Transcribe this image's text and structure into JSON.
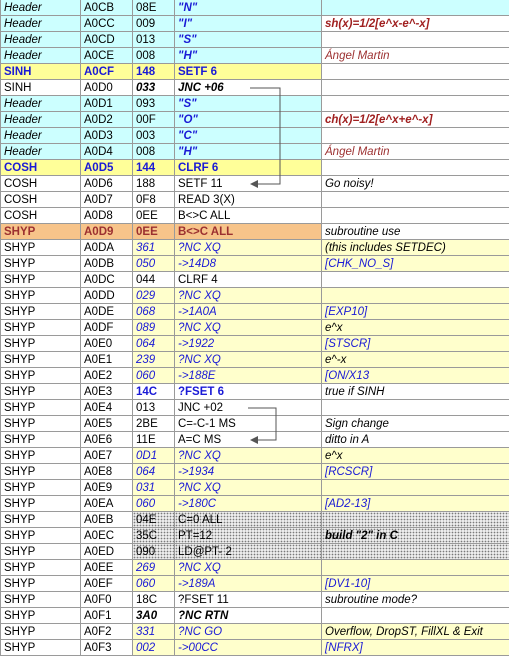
{
  "rows": [
    {
      "label": "Header",
      "addr": "A0CB",
      "code": "08E",
      "instr": "\"N\"",
      "note": ""
    },
    {
      "label": "Header",
      "addr": "A0CC",
      "code": "009",
      "instr": "\"I\"",
      "note": "sh(x)=1/2[e^x-e^-x]"
    },
    {
      "label": "Header",
      "addr": "A0CD",
      "code": "013",
      "instr": "\"S\"",
      "note": ""
    },
    {
      "label": "Header",
      "addr": "A0CE",
      "code": "008",
      "instr": "\"H\"",
      "note": "Ángel Martin"
    },
    {
      "label": "SINH",
      "addr": "A0CF",
      "code": "148",
      "instr": "SETF 6",
      "note": ""
    },
    {
      "label": "SINH",
      "addr": "A0D0",
      "code": "033",
      "instr": "JNC +06",
      "note": ""
    },
    {
      "label": "Header",
      "addr": "A0D1",
      "code": "093",
      "instr": "\"S\"",
      "note": ""
    },
    {
      "label": "Header",
      "addr": "A0D2",
      "code": "00F",
      "instr": "\"O\"",
      "note": "ch(x)=1/2[e^x+e^-x]"
    },
    {
      "label": "Header",
      "addr": "A0D3",
      "code": "003",
      "instr": "\"C\"",
      "note": ""
    },
    {
      "label": "Header",
      "addr": "A0D4",
      "code": "008",
      "instr": "\"H\"",
      "note": "Ángel Martin"
    },
    {
      "label": "COSH",
      "addr": "A0D5",
      "code": "144",
      "instr": "CLRF 6",
      "note": ""
    },
    {
      "label": "COSH",
      "addr": "A0D6",
      "code": "188",
      "instr": "SETF 11",
      "note": "Go noisy!"
    },
    {
      "label": "COSH",
      "addr": "A0D7",
      "code": "0F8",
      "instr": "READ 3(X)",
      "note": ""
    },
    {
      "label": "COSH",
      "addr": "A0D8",
      "code": "0EE",
      "instr": "B<>C ALL",
      "note": ""
    },
    {
      "label": "SHYP",
      "addr": "A0D9",
      "code": "0EE",
      "instr": "B<>C ALL",
      "note": "subroutine use"
    },
    {
      "label": "SHYP",
      "addr": "A0DA",
      "code": "361",
      "instr": "?NC XQ",
      "note": "(this includes SETDEC)"
    },
    {
      "label": "SHYP",
      "addr": "A0DB",
      "code": "050",
      "instr": "->14D8",
      "note": "[CHK_NO_S]"
    },
    {
      "label": "SHYP",
      "addr": "A0DC",
      "code": "044",
      "instr": "CLRF 4",
      "note": ""
    },
    {
      "label": "SHYP",
      "addr": "A0DD",
      "code": "029",
      "instr": "?NC XQ",
      "note": ""
    },
    {
      "label": "SHYP",
      "addr": "A0DE",
      "code": "068",
      "instr": "->1A0A",
      "note": "[EXP10]"
    },
    {
      "label": "SHYP",
      "addr": "A0DF",
      "code": "089",
      "instr": "?NC XQ",
      "note": "e^x"
    },
    {
      "label": "SHYP",
      "addr": "A0E0",
      "code": "064",
      "instr": "->1922",
      "note": "[STSCR]"
    },
    {
      "label": "SHYP",
      "addr": "A0E1",
      "code": "239",
      "instr": "?NC XQ",
      "note": "e^-x"
    },
    {
      "label": "SHYP",
      "addr": "A0E2",
      "code": "060",
      "instr": "->188E",
      "note": "[ON/X13"
    },
    {
      "label": "SHYP",
      "addr": "A0E3",
      "code": "14C",
      "instr": "?FSET 6",
      "note": "true if SINH"
    },
    {
      "label": "SHYP",
      "addr": "A0E4",
      "code": "013",
      "instr": "JNC +02",
      "note": ""
    },
    {
      "label": "SHYP",
      "addr": "A0E5",
      "code": "2BE",
      "instr": "C=-C-1 MS",
      "note": "Sign change"
    },
    {
      "label": "SHYP",
      "addr": "A0E6",
      "code": "11E",
      "instr": "A=C MS",
      "note": "ditto in A"
    },
    {
      "label": "SHYP",
      "addr": "A0E7",
      "code": "0D1",
      "instr": "?NC XQ",
      "note": "e^x"
    },
    {
      "label": "SHYP",
      "addr": "A0E8",
      "code": "064",
      "instr": "->1934",
      "note": "[RCSCR]"
    },
    {
      "label": "SHYP",
      "addr": "A0E9",
      "code": "031",
      "instr": "?NC XQ",
      "note": ""
    },
    {
      "label": "SHYP",
      "addr": "A0EA",
      "code": "060",
      "instr": "->180C",
      "note": "[AD2-13]"
    },
    {
      "label": "SHYP",
      "addr": "A0EB",
      "code": "04E",
      "instr": "C=0 ALL",
      "note": ""
    },
    {
      "label": "SHYP",
      "addr": "A0EC",
      "code": "35C",
      "instr": "PT=12",
      "note": "build \"2\" in C"
    },
    {
      "label": "SHYP",
      "addr": "A0ED",
      "code": "090",
      "instr": "LD@PT- 2",
      "note": ""
    },
    {
      "label": "SHYP",
      "addr": "A0EE",
      "code": "269",
      "instr": "?NC XQ",
      "note": ""
    },
    {
      "label": "SHYP",
      "addr": "A0EF",
      "code": "060",
      "instr": "->189A",
      "note": "[DV1-10]"
    },
    {
      "label": "SHYP",
      "addr": "A0F0",
      "code": "18C",
      "instr": "?FSET 11",
      "note": "subroutine mode?"
    },
    {
      "label": "SHYP",
      "addr": "A0F1",
      "code": "3A0",
      "instr": "?NC RTN",
      "note": ""
    },
    {
      "label": "SHYP",
      "addr": "A0F2",
      "code": "331",
      "instr": "?NC GO",
      "note": "Overflow, DropST, FillXL & Exit"
    },
    {
      "label": "SHYP",
      "addr": "A0F3",
      "code": "002",
      "instr": "->00CC",
      "note": "[NFRX]"
    }
  ]
}
